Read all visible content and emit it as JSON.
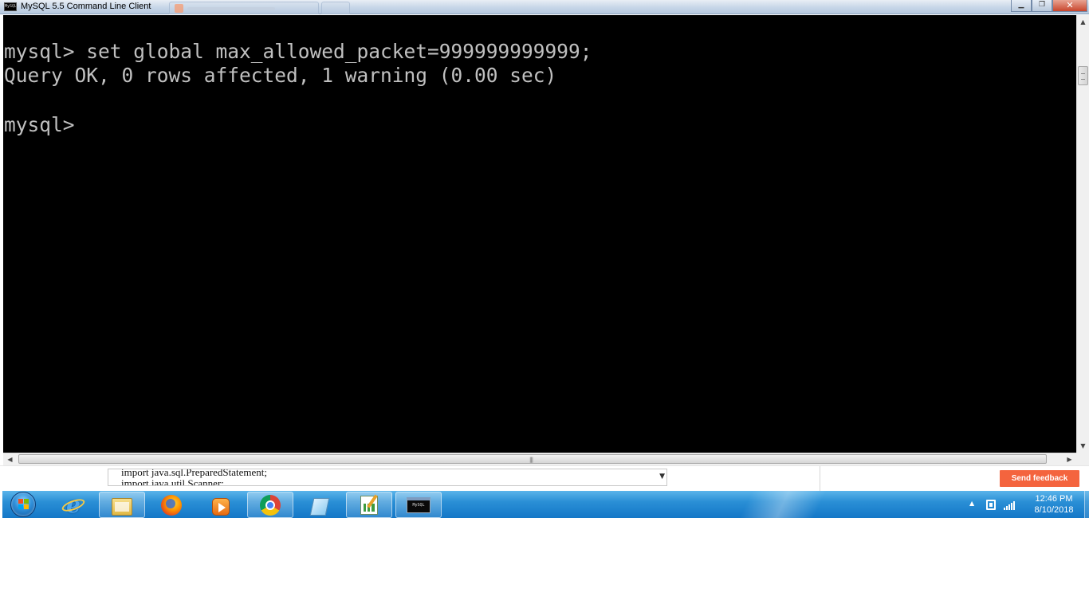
{
  "window": {
    "title": "MySQL 5.5 Command Line Client",
    "icon_label": "MySQL",
    "caption": {
      "minimize": "▁",
      "maximize": "❐",
      "close": "✕"
    }
  },
  "console": {
    "lines": [
      "mysql> set global max_allowed_packet=999999999999;",
      "Query OK, 0 rows affected, 1 warning (0.00 sec)",
      "mysql> "
    ],
    "text_color": "#c0c0c0",
    "background": "#000000"
  },
  "scrollbars": {
    "up_arrow": "▲",
    "down_arrow": "▼",
    "left_arrow": "◀",
    "right_arrow": "▶",
    "grip": "|||"
  },
  "background_window": {
    "code_lines": [
      "import java.sql.PreparedStatement;",
      "import java.util.Scanner;"
    ],
    "dropdown_arrow": "▼",
    "feedback_button": "Send feedback",
    "accent_color": "#f4643e"
  },
  "taskbar": {
    "pinned": [
      {
        "name": "internet-explorer-icon",
        "label": "e"
      },
      {
        "name": "folder-icon"
      },
      {
        "name": "firefox-icon"
      },
      {
        "name": "media-player-icon"
      },
      {
        "name": "chrome-icon"
      },
      {
        "name": "notepad-icon"
      },
      {
        "name": "editor-icon"
      },
      {
        "name": "console-icon",
        "label": "MySQL"
      }
    ],
    "tray_arrow": "▲",
    "clock": {
      "time": "12:46 PM",
      "date": "8/10/2018"
    }
  }
}
